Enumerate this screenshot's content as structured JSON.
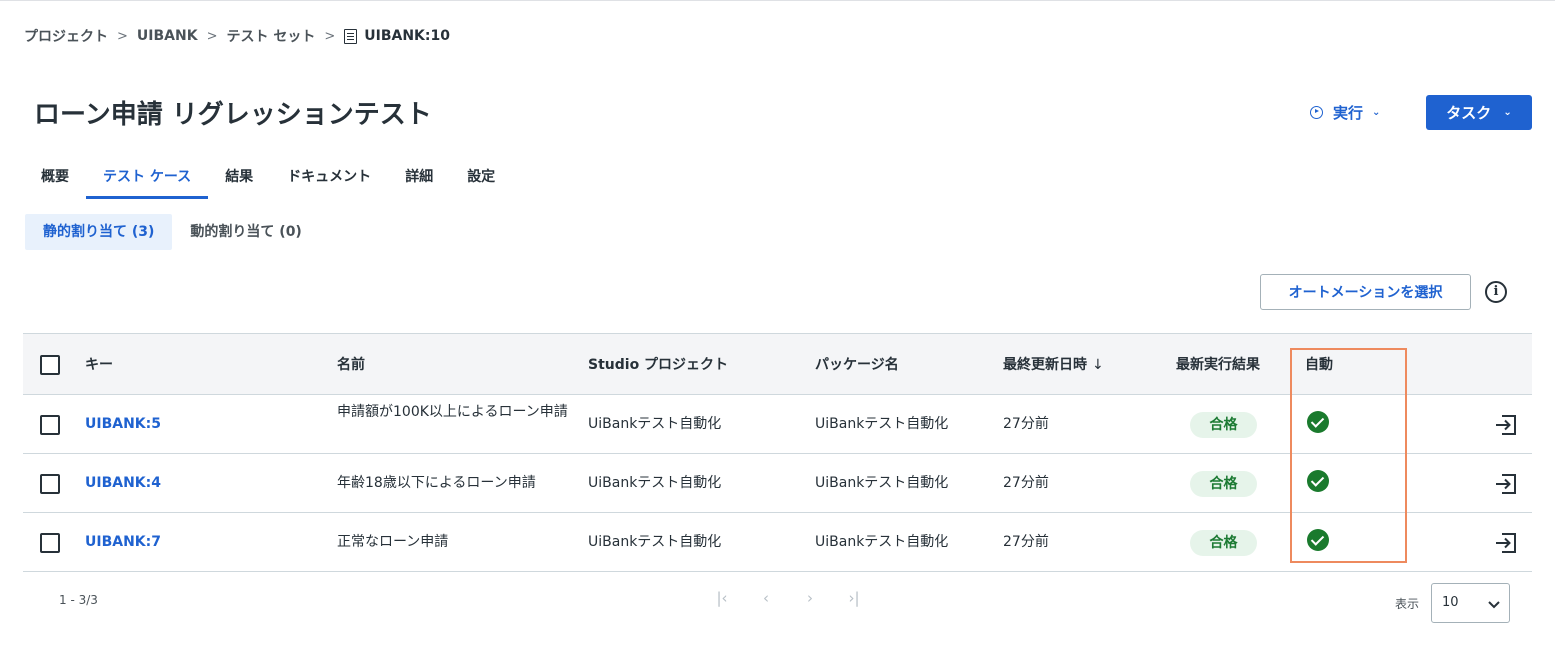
{
  "breadcrumb": {
    "items": [
      "プロジェクト",
      "UIBANK",
      "テスト セット"
    ],
    "current": "UIBANK:10"
  },
  "page": {
    "title": "ローン申請 リグレッションテスト"
  },
  "actions": {
    "run_label": "実行",
    "task_label": "タスク"
  },
  "tabs": [
    "概要",
    "テスト ケース",
    "結果",
    "ドキュメント",
    "詳細",
    "設定"
  ],
  "active_tab": "テスト ケース",
  "subtabs": [
    "静的割り当て (3)",
    "動的割り当て (0)"
  ],
  "toolbar": {
    "select_automation_label": "オートメーションを選択"
  },
  "table": {
    "columns": [
      "キー",
      "名前",
      "Studio プロジェクト",
      "パッケージ名",
      "最終更新日時",
      "最新実行結果",
      "自動"
    ],
    "sort_indicator": "↓",
    "rows": [
      {
        "key": "UIBANK:5",
        "name": "申請額が100K以上によるローン申請",
        "studio_project": "UiBankテスト自動化",
        "package": "UiBankテスト自動化",
        "updated": "27分前",
        "result": "合格"
      },
      {
        "key": "UIBANK:4",
        "name": "年齢18歳以下によるローン申請",
        "studio_project": "UiBankテスト自動化",
        "package": "UiBankテスト自動化",
        "updated": "27分前",
        "result": "合格"
      },
      {
        "key": "UIBANK:7",
        "name": "正常なローン申請",
        "studio_project": "UiBankテスト自動化",
        "package": "UiBankテスト自動化",
        "updated": "27分前",
        "result": "合格"
      }
    ]
  },
  "footer": {
    "range": "1 - 3/3",
    "per_page_label": "表示",
    "per_page_value": "10"
  },
  "colors": {
    "accent": "#1f62d0",
    "pass_badge_bg": "#e6f4ea",
    "pass_badge_text": "#1d7b34",
    "highlight": "#ee8a5e"
  }
}
